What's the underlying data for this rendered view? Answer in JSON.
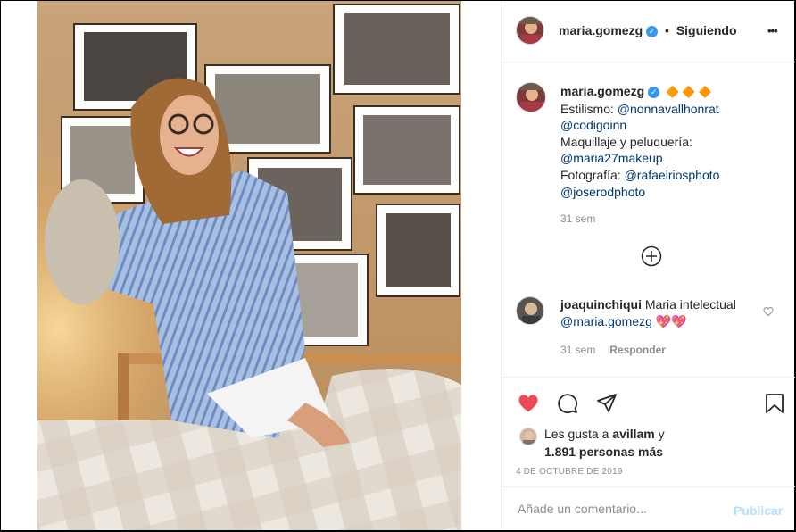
{
  "post": {
    "author": "maria.gomezg",
    "follow_status": "Siguiendo",
    "separator": "•",
    "more_label": "•••"
  },
  "caption": {
    "author": "maria.gomezg",
    "diamonds": "🔶 🔶 🔶",
    "styling_label": "Estilismo:",
    "styling_handle_1": "@nonnavallhonrat",
    "styling_handle_2": "@codigoinn",
    "makeup_label": "Maquillaje y peluquería:",
    "makeup_handle": "@maria27makeup",
    "photo_label": "Fotografía:",
    "photo_handle_1": "@rafaelriosphoto",
    "photo_handle_2": "@joserodphoto",
    "time": "31 sem"
  },
  "comment": {
    "author": "joaquinchiqui",
    "text": "Maria intelectual",
    "mention": "@maria.gomezg",
    "emoji": "💖💖",
    "time": "31 sem",
    "reply_label": "Responder"
  },
  "likes": {
    "prefix": "Les gusta a",
    "first_user": "avillam",
    "connector": "y",
    "others": "1.891 personas más"
  },
  "date": "4 DE OCTUBRE DE 2019",
  "add_comment": {
    "placeholder": "Añade un comentario...",
    "publish_label": "Publicar"
  },
  "colors": {
    "like_red": "#ed4956",
    "link_blue": "#00376b",
    "verified_blue": "#3897f0",
    "publish_blue": "#b2dffc",
    "muted_gray": "#8e8e8e"
  }
}
